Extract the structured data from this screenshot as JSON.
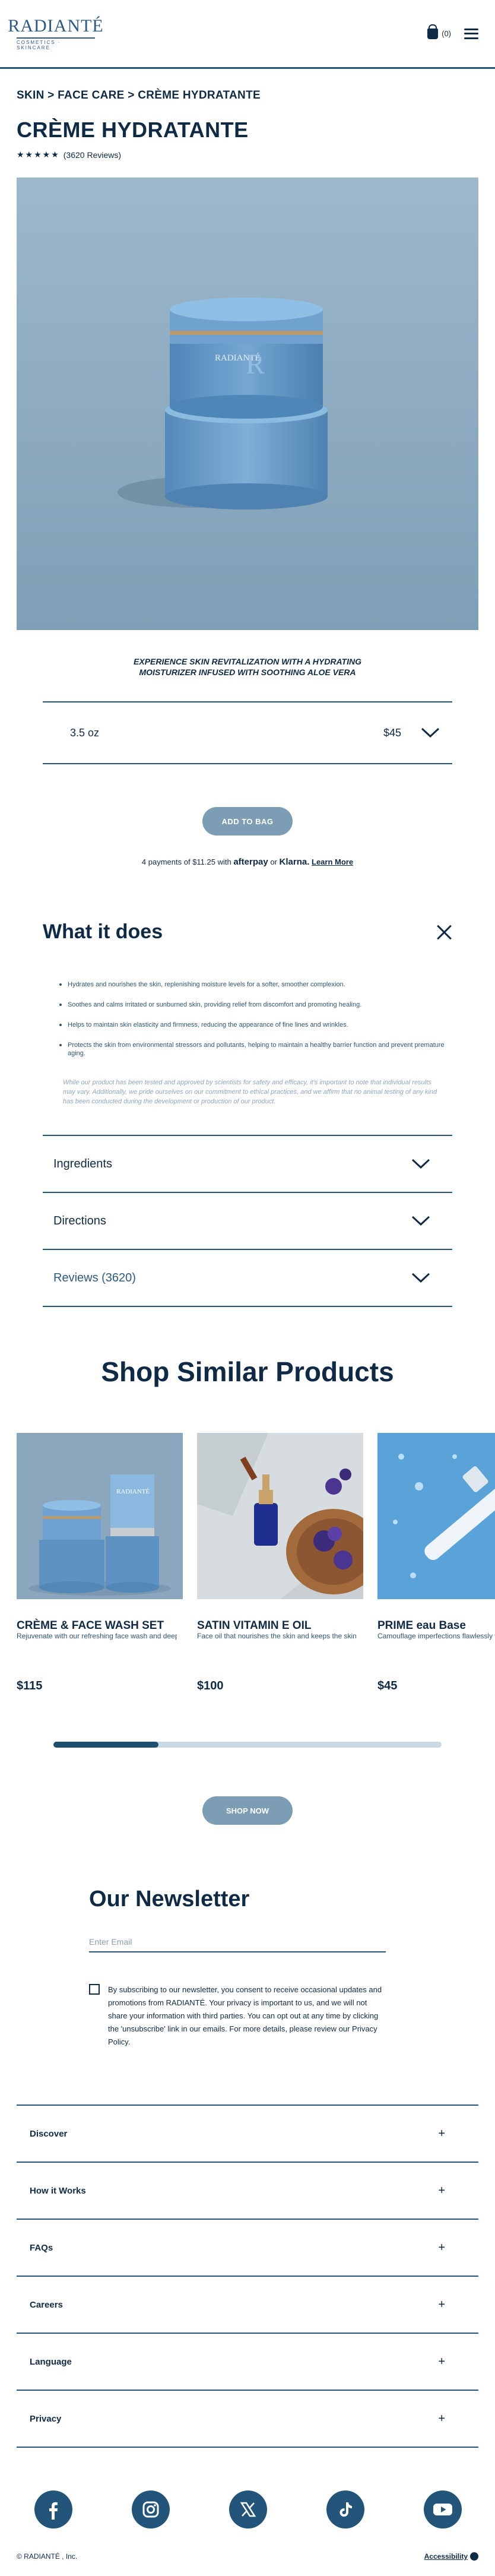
{
  "header": {
    "logo_name": "RADIANTÉ",
    "logo_tagline": "COSMETICS · SKINCARE",
    "cart_count": "(0)"
  },
  "product": {
    "breadcrumb": "SKIN > FACE CARE > CRÈME HYDRATANTE",
    "title": "CRÈME HYDRATANTE",
    "stars": "★★★★★",
    "rating_value": 5,
    "reviews": "(3620 Reviews)",
    "jar_label": "RADIANTÉ",
    "description": "EXPERIENCE SKIN REVITALIZATION WITH A HYDRATING MOISTURIZER INFUSED WITH SOOTHING ALOE VERA",
    "size": "3.5 oz",
    "price": "$45",
    "add_to_bag": "ADD TO BAG",
    "pay_prefix": "4 payments of $11.25 with",
    "pay_afterpay": "afterpay",
    "pay_or": "or",
    "pay_klarna": "Klarna.",
    "pay_learn_more": "Learn More"
  },
  "what_it_does": {
    "title": "What it does",
    "benefits": [
      "Hydrates and nourishes the skin, replenishing moisture levels for a softer, smoother complexion.",
      "Soothes and calms irritated or sunburned skin, providing relief from discomfort and promoting healing.",
      "Helps to maintain skin elasticity and firmness, reducing the appearance of fine lines and wrinkles.",
      "Protects the skin from environmental stressors and pollutants, helping to maintain a healthy barrier function and prevent premature aging."
    ],
    "disclaimer": "While our product has been tested and approved by scientists for safety and efficacy, it's important to note that individual results may vary. Additionally, we pride ourselves on our commitment to ethical practices, and we affirm that no animal testing of any kind has been conducted during the development or production of our product."
  },
  "accordion": {
    "ingredients": "Ingredients",
    "directions": "Directions",
    "reviews": "Reviews (3620)"
  },
  "similar": {
    "title": "Shop Similar Products",
    "products": [
      {
        "name": "CRÈME & FACE WASH SET",
        "desc": "Rejuvenate with our refreshing face wash and deeply hydrating moisturizer duo.",
        "price": "$115",
        "img_label": "RADIANTÉ"
      },
      {
        "name": "SATIN VITAMIN E OIL",
        "desc": "Face oil that nourishes the skin and keeps the skin protected from sun damage.",
        "price": "$100"
      },
      {
        "name": "PRIME eau Base",
        "desc": "Camouflage imperfections flawlessly with our lightweight and long-lasting primer base.",
        "price": "$45"
      }
    ],
    "scroll_fraction": 0.27,
    "shop_now": "SHOP NOW"
  },
  "newsletter": {
    "title": "Our Newsletter",
    "email_placeholder": "Enter Email",
    "consent": "By subscribing to our newsletter, you consent to receive occasional updates and promotions from RADIANTÉ. Your privacy is important to us, and we will not share your information with third parties. You can opt out at any time by clicking the 'unsubscribe' link in our emails. For more details, please review our Privacy Policy."
  },
  "footer": {
    "links": [
      "Discover",
      "How it Works",
      "FAQs",
      "Careers",
      "Language",
      "Privacy"
    ],
    "expand_symbol": "+",
    "copyright": "© RADIANTÉ , Inc.",
    "accessibility": "Accessibility"
  },
  "colors": {
    "brand_navy": "#0f2a44",
    "accent_blue": "#23547a",
    "button_blue": "#7d9db5",
    "hero_bg": "#8ba8be"
  },
  "icons": [
    "shopping-bag-icon",
    "hamburger-menu-icon",
    "chevron-down-icon",
    "close-icon",
    "plus-icon",
    "facebook-icon",
    "instagram-icon",
    "x-icon",
    "tiktok-icon",
    "youtube-icon",
    "accessibility-icon"
  ]
}
